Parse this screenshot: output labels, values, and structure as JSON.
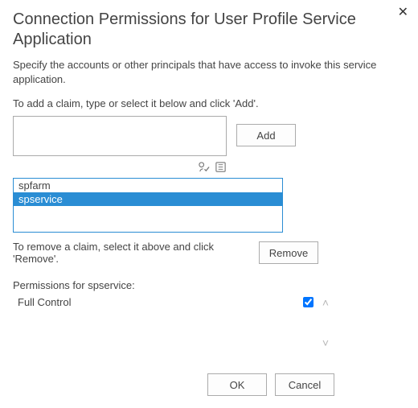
{
  "header": {
    "title": "Connection Permissions for User Profile Service Application",
    "description": "Specify the accounts or other principals that have access to invoke this service application.",
    "add_instruction": "To add a claim, type or select it below and click 'Add'."
  },
  "close_symbol": "✕",
  "input": {
    "value": ""
  },
  "buttons": {
    "add": "Add",
    "remove": "Remove",
    "ok": "OK",
    "cancel": "Cancel"
  },
  "claims": {
    "items": [
      {
        "name": "spfarm",
        "selected": false
      },
      {
        "name": "spservice",
        "selected": true
      }
    ]
  },
  "remove_instruction": "To remove a claim, select it above and click 'Remove'.",
  "permissions": {
    "label": "Permissions for spservice:",
    "items": [
      {
        "name": "Full Control",
        "checked": true
      }
    ]
  },
  "scroll": {
    "up": "˄",
    "down": "˅"
  }
}
